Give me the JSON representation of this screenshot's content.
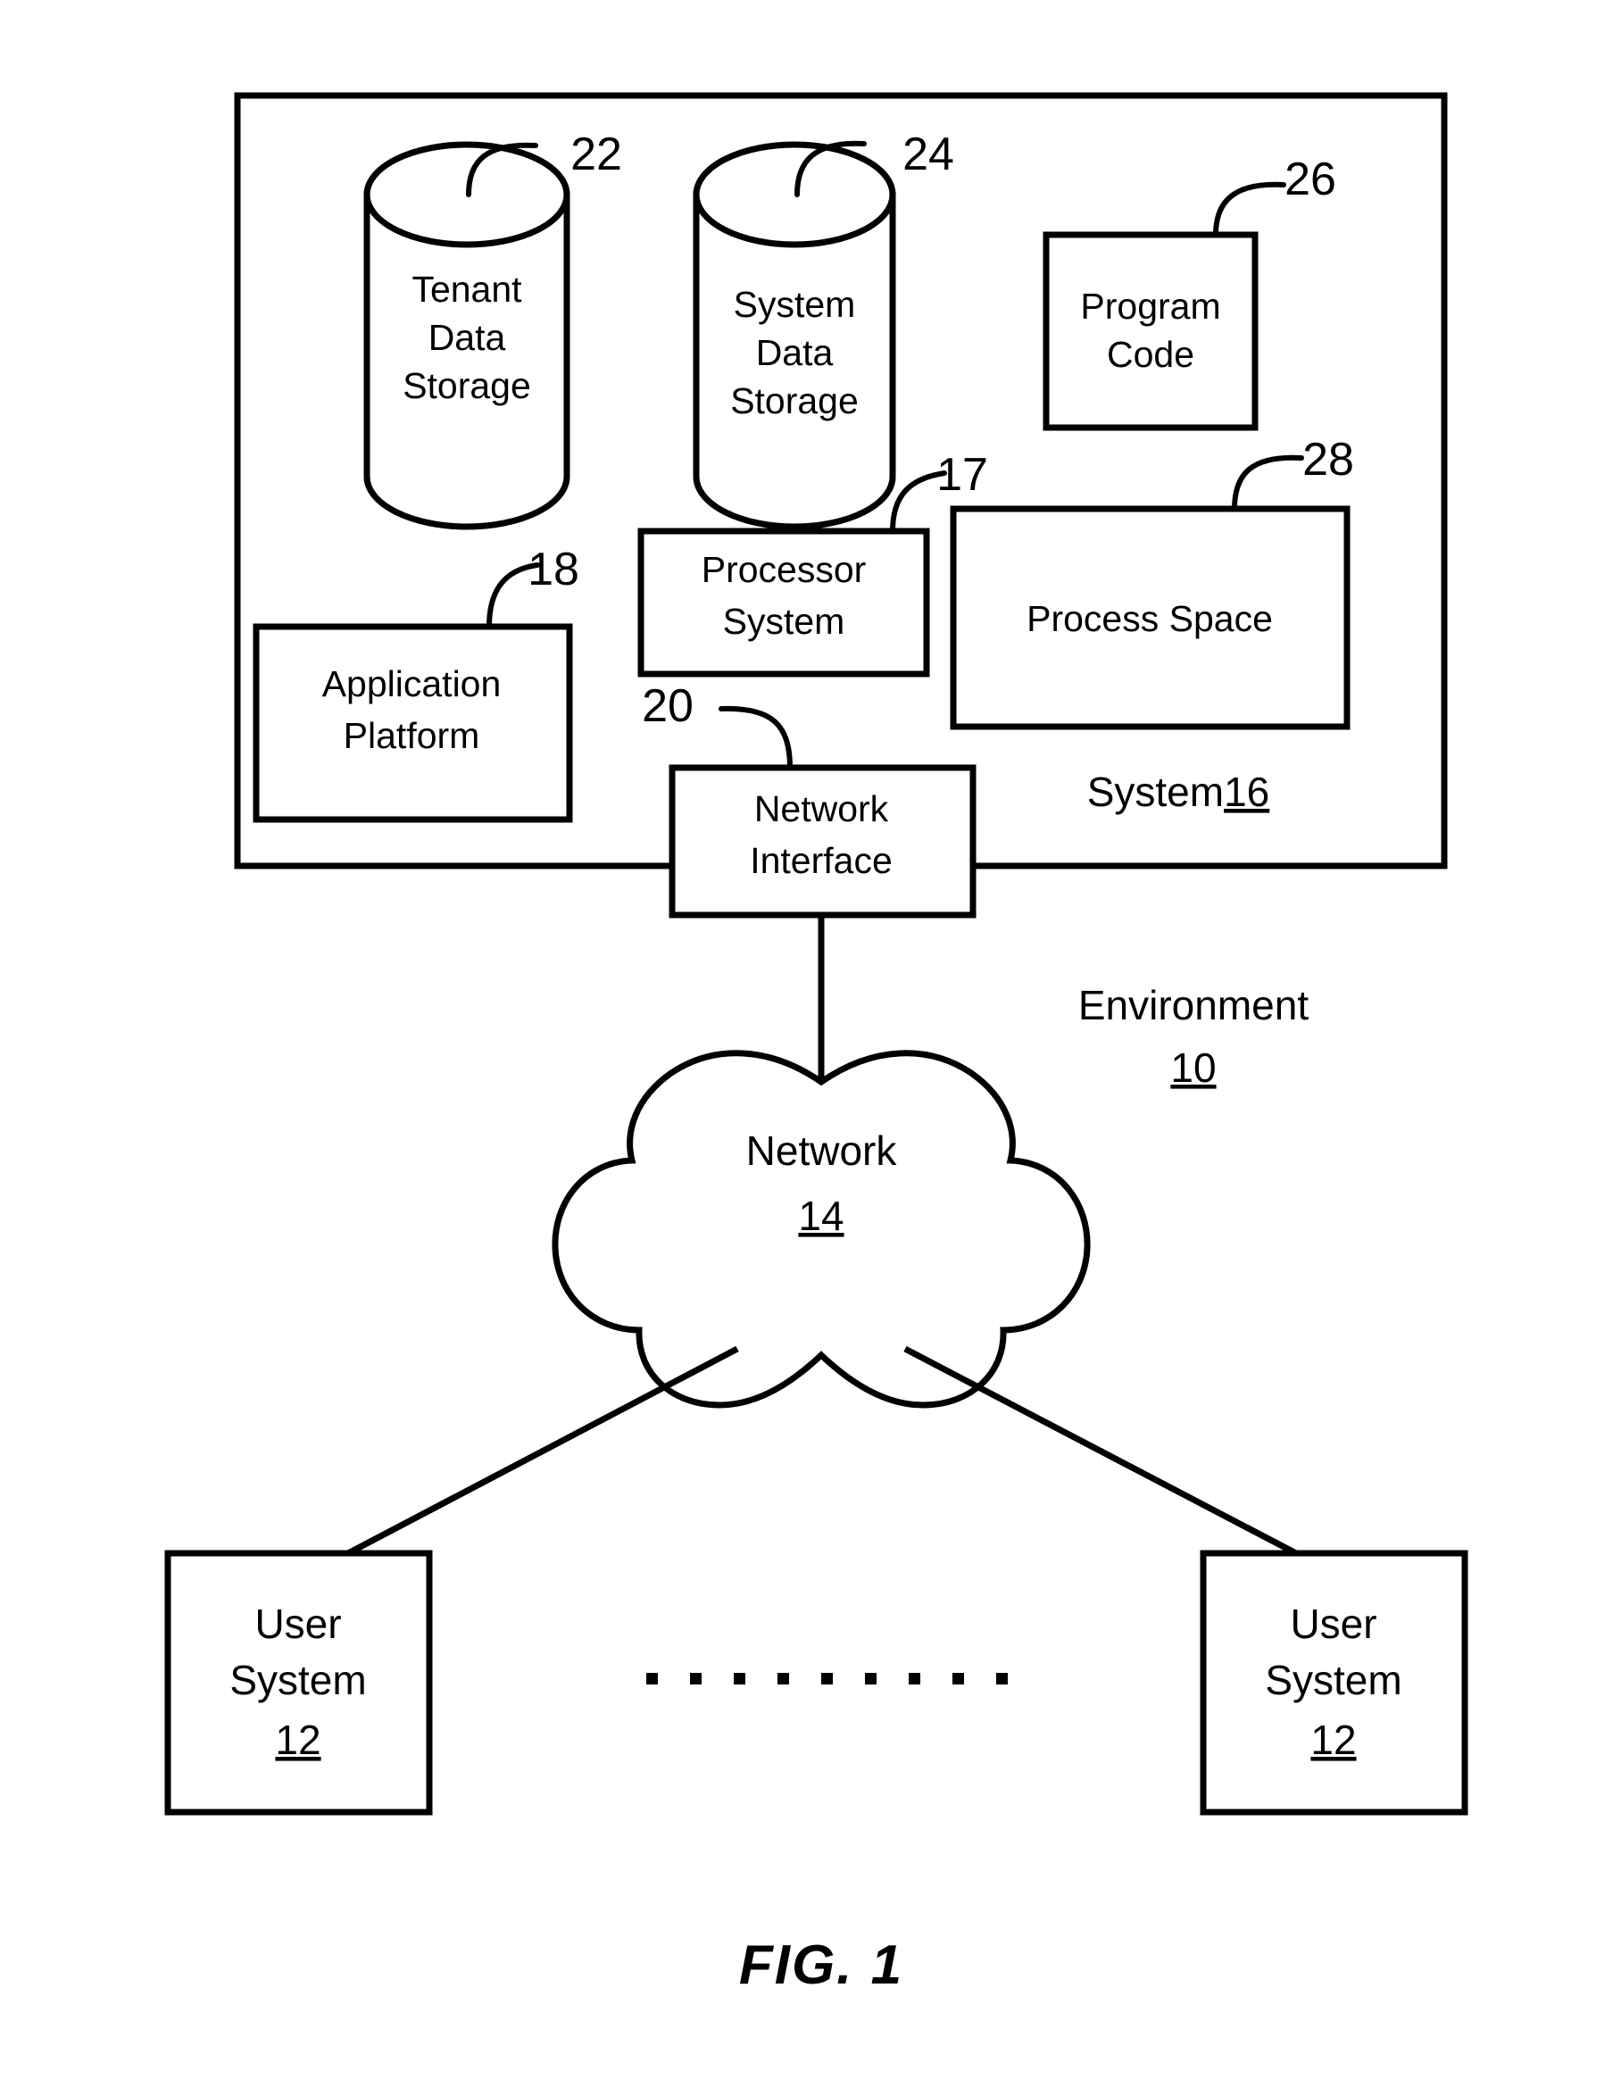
{
  "figure": {
    "caption": "FIG. 1",
    "environment_label": "Environment",
    "environment_ref": "10",
    "system_label": "System",
    "system_ref": "16"
  },
  "nodes": {
    "tenant_data_storage": {
      "lines": [
        "Tenant",
        "Data",
        "Storage"
      ],
      "ref": "22",
      "shape": "cylinder"
    },
    "system_data_storage": {
      "lines": [
        "System",
        "Data",
        "Storage"
      ],
      "ref": "24",
      "shape": "cylinder"
    },
    "program_code": {
      "lines": [
        "Program",
        "Code"
      ],
      "ref": "26",
      "shape": "rect"
    },
    "process_space": {
      "lines": [
        "Process Space"
      ],
      "ref": "28",
      "shape": "rect"
    },
    "processor_system": {
      "lines": [
        "Processor",
        "System"
      ],
      "ref": "17",
      "shape": "rect"
    },
    "application_platform": {
      "lines": [
        "Application",
        "Platform"
      ],
      "ref": "18",
      "shape": "rect"
    },
    "network_interface": {
      "lines": [
        "Network",
        "Interface"
      ],
      "ref": "20",
      "shape": "rect"
    },
    "network": {
      "lines": [
        "Network"
      ],
      "ref": "14",
      "shape": "cloud"
    },
    "user_system_left": {
      "lines": [
        "User",
        "System"
      ],
      "ref": "12",
      "shape": "rect"
    },
    "user_system_right": {
      "lines": [
        "User",
        "System"
      ],
      "ref": "12",
      "shape": "rect"
    }
  },
  "ellipsis": {
    "dot_count": 9,
    "glyph": "."
  },
  "colors": {
    "stroke": "#000000",
    "background": "#ffffff",
    "text": "#000000"
  }
}
